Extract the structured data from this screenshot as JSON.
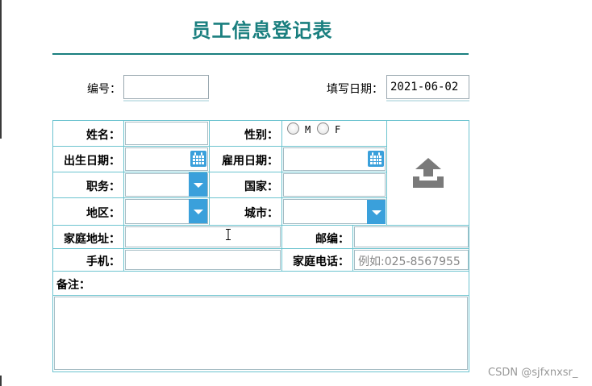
{
  "title": "员工信息登记表",
  "header": {
    "number_label": "编号：",
    "number_value": "",
    "fill_date_label": "填写日期：",
    "fill_date_value": "2021-06-02"
  },
  "form": {
    "name_label": "姓名：",
    "gender_label": "性别：",
    "gender_options": [
      "M",
      "F"
    ],
    "birth_label": "出生日期：",
    "hire_label": "雇用日期：",
    "job_label": "职务：",
    "country_label": "国家：",
    "region_label": "地区：",
    "city_label": "城市：",
    "address_label": "家庭地址：",
    "zip_label": "邮编：",
    "mobile_label": "手机：",
    "home_phone_label": "家庭电话：",
    "home_phone_placeholder": "例如:025-8567955",
    "remarks_label": "备注："
  },
  "colors": {
    "accent": "#1a7f7f",
    "border": "#6cc3cf",
    "button": "#3aa0db"
  },
  "icons": [
    "upload-icon",
    "calendar-icon",
    "chevron-down-icon"
  ],
  "watermark": "CSDN @sjfxnxsr_"
}
